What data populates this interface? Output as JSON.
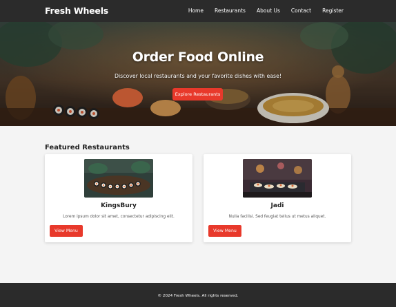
{
  "header": {
    "brand": "Fresh Wheels",
    "nav": [
      {
        "label": "Home"
      },
      {
        "label": "Restaurants"
      },
      {
        "label": "About Us"
      },
      {
        "label": "Contact"
      },
      {
        "label": "Register"
      }
    ]
  },
  "hero": {
    "title": "Order Food Online",
    "subtitle": "Discover local restaurants and your favorite dishes with ease!",
    "cta_label": "Explore Restaurants"
  },
  "featured": {
    "title": "Featured Restaurants",
    "restaurants": [
      {
        "name": "KingsBury",
        "description": "Lorem ipsum dolor sit amet, consectetur adipiscing elit.",
        "button_label": "View Menu",
        "image": "sushi-platter-image"
      },
      {
        "name": "Jadi",
        "description": "Nulla facilisi. Sed feugiat tellus ut metus aliquet.",
        "button_label": "View Menu",
        "image": "restaurant-interior-image"
      }
    ]
  },
  "footer": {
    "copyright": "© 2024 Fresh Wheels. All rights reserved."
  },
  "colors": {
    "header_bg": "#2b2b2b",
    "accent": "#e8392b",
    "page_bg": "#f4f4f4"
  }
}
